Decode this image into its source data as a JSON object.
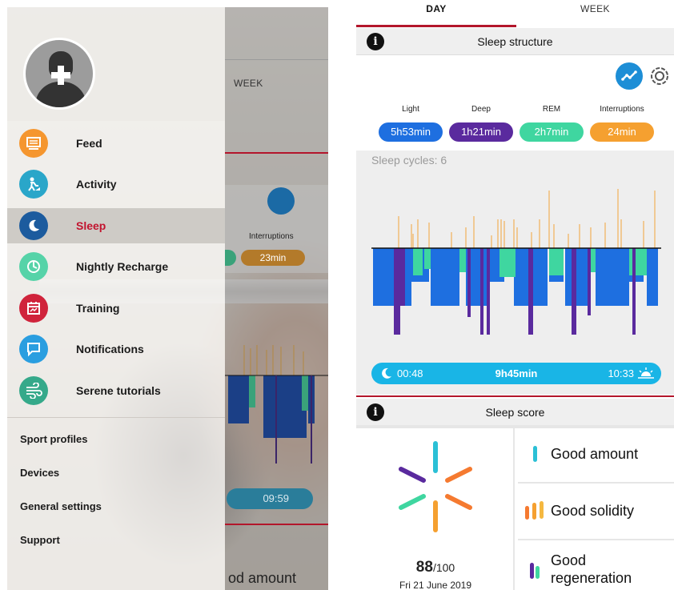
{
  "left_screen": {
    "drawer": {
      "nav_items": [
        {
          "label": "Feed",
          "icon": "feed-icon",
          "color": "#f5962f"
        },
        {
          "label": "Activity",
          "icon": "activity-icon",
          "color": "#2aa6c9"
        },
        {
          "label": "Sleep",
          "icon": "moon-icon",
          "color": "#1c5b9e",
          "selected": true
        },
        {
          "label": "Nightly Recharge",
          "icon": "recharge-icon",
          "color": "#56d3a8"
        },
        {
          "label": "Training",
          "icon": "calendar-icon",
          "color": "#d0233b"
        },
        {
          "label": "Notifications",
          "icon": "chat-icon",
          "color": "#2a9ee0"
        },
        {
          "label": "Serene tutorials",
          "icon": "breathing-icon",
          "color": "#35a98a"
        }
      ],
      "plain_items": [
        "Sport profiles",
        "Devices",
        "General settings",
        "Support"
      ]
    },
    "underlay": {
      "week_tab": "WEEK",
      "interruptions_label": "Interruptions",
      "interruptions_value": "23min",
      "wake_time": "09:59",
      "bottom_text": "od amount"
    }
  },
  "right_screen": {
    "tabs": {
      "day": "DAY",
      "week": "WEEK",
      "active": "DAY"
    },
    "sleep_structure": {
      "title": "Sleep structure",
      "stats": [
        {
          "label": "Light",
          "value": "5h53min",
          "color": "#1e6fe0"
        },
        {
          "label": "Deep",
          "value": "1h21min",
          "color": "#5a2a9e"
        },
        {
          "label": "REM",
          "value": "2h7min",
          "color": "#3fd6a0"
        },
        {
          "label": "Interruptions",
          "value": "24min",
          "color": "#f5a030"
        }
      ],
      "sleep_cycles": "Sleep cycles: 6",
      "start_time": "00:48",
      "duration": "9h45min",
      "end_time": "10:33"
    },
    "sleep_score": {
      "title": "Sleep score",
      "score": "88",
      "score_max": "/100",
      "date": "Fri 21 June 2019",
      "components": [
        {
          "label": "Good amount",
          "icon": "amount-bar-icon"
        },
        {
          "label": "Good solidity",
          "icon": "solidity-bars-icon"
        },
        {
          "label": "Good regeneration",
          "icon": "regeneration-bars-icon"
        }
      ]
    }
  },
  "colors": {
    "accent_red": "#b3162b",
    "light": "#1e6fe0",
    "deep": "#5a2a9e",
    "rem": "#3fd6a0",
    "interruption": "#f5a030",
    "timebar": "#19b5e6"
  }
}
